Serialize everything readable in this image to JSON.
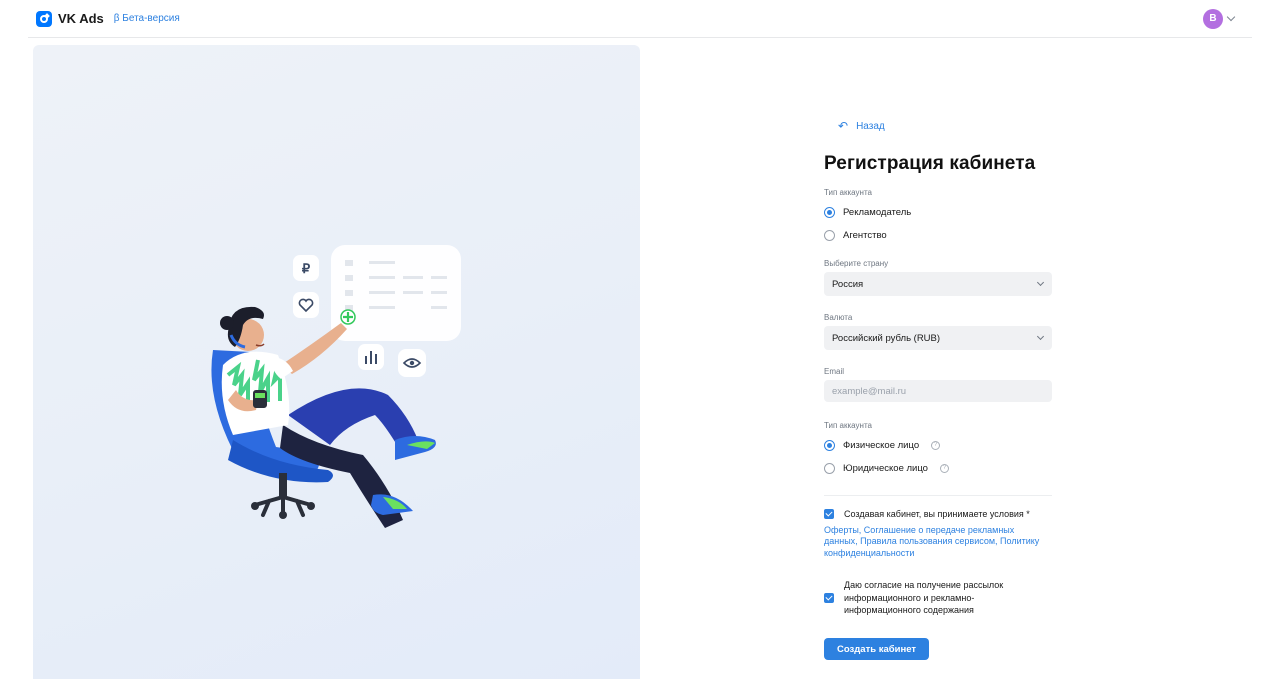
{
  "header": {
    "brand": "VK Ads",
    "beta": "β Бета-версия",
    "avatar_letter": "В"
  },
  "form": {
    "back_label": "Назад",
    "title": "Регистрация кабинета",
    "account_type_label": "Тип аккаунта",
    "account_type_options": [
      "Рекламодатель",
      "Агентство"
    ],
    "account_type_selected": "Рекламодатель",
    "country_label": "Выберите страну",
    "country_value": "Россия",
    "currency_label": "Валюта",
    "currency_value": "Российский рубль (RUB)",
    "email_label": "Email",
    "email_placeholder": "example@mail.ru",
    "person_type_label": "Тип аккаунта",
    "person_type_options": [
      "Физическое лицо",
      "Юридическое лицо"
    ],
    "person_type_selected": "Физическое лицо",
    "terms_text": "Создавая кабинет, вы принимаете условия *",
    "terms_links": "Оферты, Соглашение о передаче рекламных данных, Правила пользования сервисом, Политику конфиденциальности",
    "newsletter_text": "Даю согласие на получение рассылок информационного и рекламно-информационного содержания",
    "submit_label": "Создать кабинет"
  },
  "illustration": {
    "currency_symbol": "₽"
  },
  "colors": {
    "accent": "#2d81e0",
    "avatar_bg": "#b36fe0",
    "field_bg": "#f0f1f3"
  },
  "icons": {
    "logo": "vk-ads-logo-icon",
    "back": "undo-arrow-icon",
    "chevron": "chevron-down-icon",
    "help": "question-circle-icon"
  }
}
